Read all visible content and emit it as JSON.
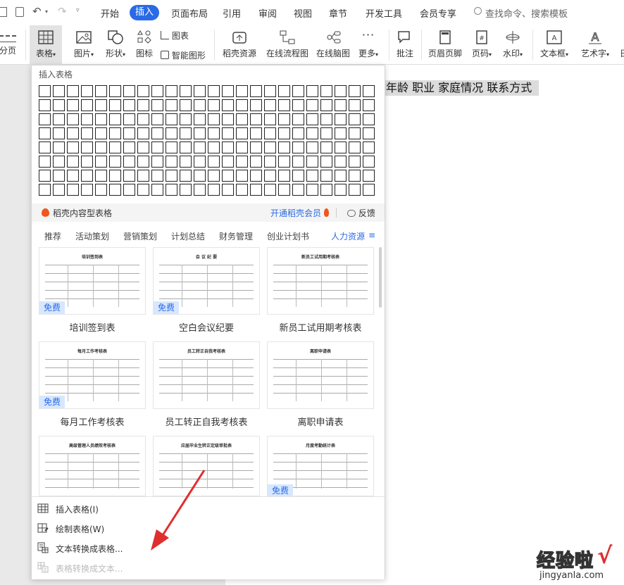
{
  "menubar": {
    "items": [
      "开始",
      "插入",
      "页面布局",
      "引用",
      "审阅",
      "视图",
      "章节",
      "开发工具",
      "会员专享"
    ],
    "search_placeholder": "查找命令、搜索模板"
  },
  "ribbon": {
    "partial_left": "分页",
    "table": "表格",
    "image": "图片",
    "shape": "形状",
    "icon": "图标",
    "chart": "图表",
    "smart_shape": "智能图形",
    "resources": "稻壳资源",
    "online_flowchart": "在线流程图",
    "online_mindmap": "在线脑图",
    "more": "更多",
    "comment": "批注",
    "header_footer": "页眉页脚",
    "page_number": "页码",
    "watermark": "水印",
    "textbox": "文本框",
    "wordart": "艺术字",
    "partial_right": "日"
  },
  "document": {
    "selected_text": "年龄  职业  家庭情况  联系方式"
  },
  "dropdown": {
    "title": "插入表格",
    "promo_label": "稻壳内容型表格",
    "promo_link": "开通稻壳会员",
    "feedback": "反馈",
    "tabs": [
      "推荐",
      "活动策划",
      "营销策划",
      "计划总结",
      "财务管理",
      "创业计划书",
      "人力资源"
    ],
    "free_badge": "免费",
    "templates": [
      {
        "name": "培训签到表",
        "title": "培训签到表"
      },
      {
        "name": "空白会议纪要",
        "title": "会 议 纪 要"
      },
      {
        "name": "新员工试用期考核表",
        "title": "新员工试用期考核表"
      },
      {
        "name": "每月工作考核表",
        "title": "每月工作考核表"
      },
      {
        "name": "员工转正自我考核表",
        "title": "员工转正自我考核表"
      },
      {
        "name": "离职申请表",
        "title": "离职申请表"
      },
      {
        "name": "",
        "title": "高级管理人员绩效考核表"
      },
      {
        "name": "",
        "title": "应届毕业生转正定级审批表"
      },
      {
        "name": "",
        "title": "月度考勤统计表"
      }
    ],
    "menu": {
      "insert_table": "插入表格(I)",
      "draw_table": "绘制表格(W)",
      "text_to_table": "文本转换成表格...",
      "table_to_text": "表格转换成文本..."
    }
  },
  "watermark": {
    "text": "经验啦",
    "url": "jingyanla.com",
    "check": "√"
  },
  "colors": {
    "accent": "#2a6ae6",
    "arrow": "#e02e2e",
    "promo_icon": "#f0561d"
  }
}
